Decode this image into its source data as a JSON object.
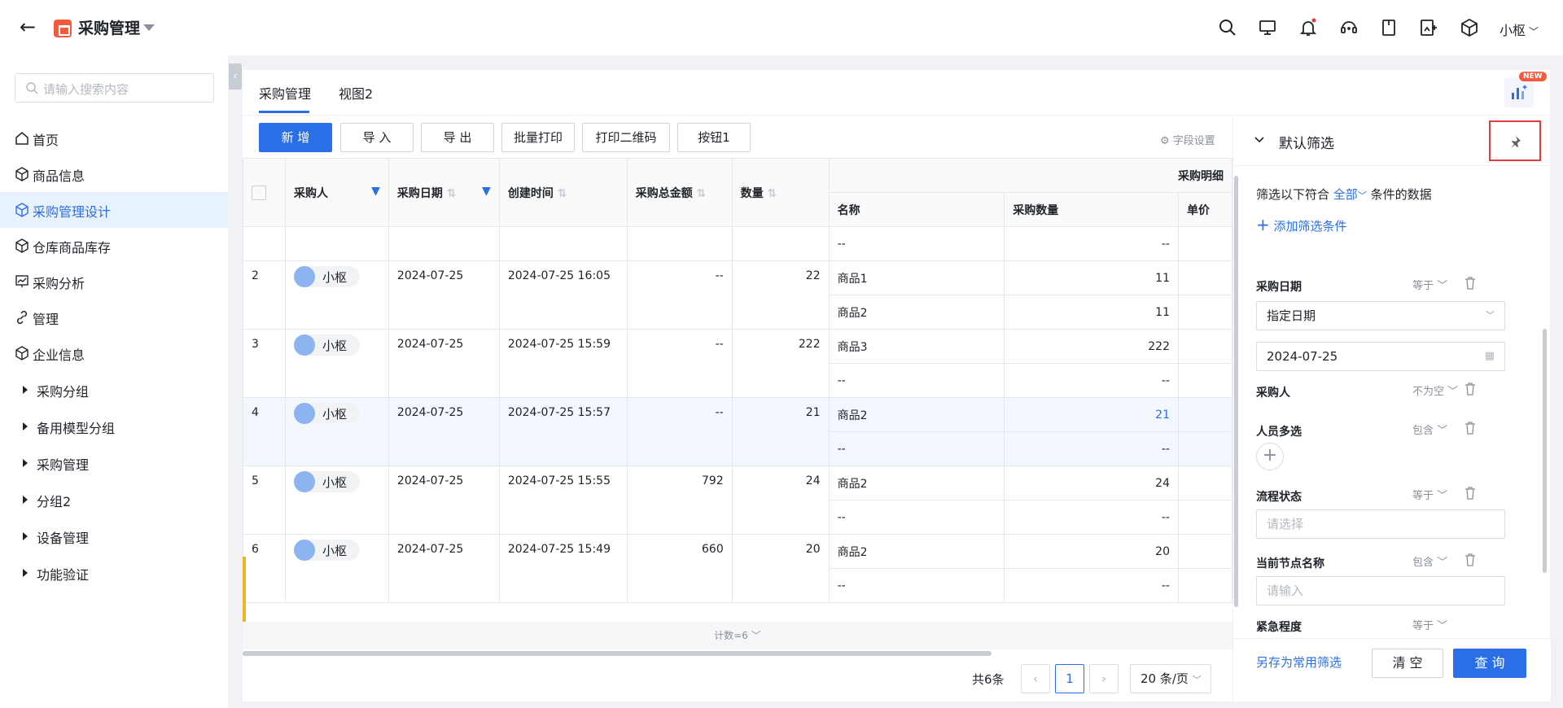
{
  "app": {
    "title": "采购管理",
    "user": "小枢"
  },
  "sidebar": {
    "search_placeholder": "请输入搜索内容",
    "items": [
      {
        "label": "首页",
        "icon": "home-icon"
      },
      {
        "label": "商品信息",
        "icon": "cube-icon"
      },
      {
        "label": "采购管理设计",
        "icon": "cube-icon",
        "active": true
      },
      {
        "label": "仓库商品库存",
        "icon": "cube-icon"
      },
      {
        "label": "采购分析",
        "icon": "chart-icon"
      },
      {
        "label": "管理",
        "icon": "link-icon"
      },
      {
        "label": "企业信息",
        "icon": "cube-icon"
      }
    ],
    "groups": [
      "采购分组",
      "备用模型分组",
      "采购管理",
      "分组2",
      "设备管理",
      "功能验证"
    ]
  },
  "tabs": [
    "采购管理",
    "视图2"
  ],
  "new_badge": "NEW",
  "toolbar": {
    "buttons": [
      "新 增",
      "导 入",
      "导 出",
      "批量打印",
      "打印二维码",
      "按钮1"
    ],
    "field_settings": "字段设置"
  },
  "table": {
    "headers": {
      "buyer": "采购人",
      "date": "采购日期",
      "created": "创建时间",
      "amount": "采购总金额",
      "qty": "数量",
      "detail_group": "采购明细",
      "name": "名称",
      "detail_qty": "采购数量",
      "unit_price": "单价"
    },
    "first_partial": {
      "name": "--",
      "qty": "--"
    },
    "rows": [
      {
        "no": "2",
        "buyer": "小枢",
        "date": "2024-07-25",
        "created": "2024-07-25 16:05",
        "amount": "--",
        "qty": "22",
        "details": [
          [
            "商品1",
            "11"
          ],
          [
            "商品2",
            "11"
          ]
        ]
      },
      {
        "no": "3",
        "buyer": "小枢",
        "date": "2024-07-25",
        "created": "2024-07-25 15:59",
        "amount": "--",
        "qty": "222",
        "details": [
          [
            "商品3",
            "222"
          ],
          [
            "--",
            "--"
          ]
        ]
      },
      {
        "no": "4",
        "buyer": "小枢",
        "date": "2024-07-25",
        "created": "2024-07-25 15:57",
        "amount": "--",
        "qty": "21",
        "details": [
          [
            "商品2",
            "21"
          ],
          [
            "--",
            "--"
          ]
        ]
      },
      {
        "no": "5",
        "buyer": "小枢",
        "date": "2024-07-25",
        "created": "2024-07-25 15:55",
        "amount": "792",
        "qty": "24",
        "details": [
          [
            "商品2",
            "24"
          ],
          [
            "--",
            "--"
          ]
        ]
      },
      {
        "no": "6",
        "buyer": "小枢",
        "date": "2024-07-25",
        "created": "2024-07-25 15:49",
        "amount": "660",
        "qty": "20",
        "details": [
          [
            "商品2",
            "20"
          ],
          [
            "--",
            "--"
          ]
        ]
      }
    ],
    "count_label": "计数=6"
  },
  "pager": {
    "total": "共6条",
    "current": "1",
    "size": "20 条/页"
  },
  "filter": {
    "title": "默认筛选",
    "match_prefix": "筛选以下符合",
    "match_mode": "全部",
    "match_suffix": "条件的数据",
    "add_condition": "添加筛选条件",
    "conditions": [
      {
        "label": "采购日期",
        "op": "等于",
        "select": "指定日期",
        "date": "2024-07-25"
      },
      {
        "label": "采购人",
        "op": "不为空"
      },
      {
        "label": "人员多选",
        "op": "包含"
      },
      {
        "label": "流程状态",
        "op": "等于",
        "placeholder": "请选择"
      },
      {
        "label": "当前节点名称",
        "op": "包含",
        "placeholder": "请输入"
      },
      {
        "label": "紧急程度",
        "op": "等于"
      }
    ],
    "save_common": "另存为常用筛选",
    "clear": "清 空",
    "query": "查 询"
  }
}
